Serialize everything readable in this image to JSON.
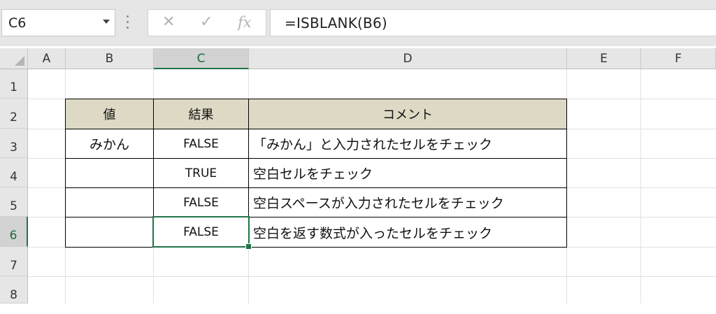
{
  "name_box": {
    "value": "C6"
  },
  "formula_bar": {
    "cancel_glyph": "✕",
    "enter_glyph": "✓",
    "fx_label": "fx",
    "formula": "=ISBLANK(B6)"
  },
  "columns": [
    "A",
    "B",
    "C",
    "D",
    "E",
    "F"
  ],
  "rows": [
    "1",
    "2",
    "3",
    "4",
    "5",
    "6",
    "7",
    "8"
  ],
  "selected_cell": {
    "column": "C",
    "row": "6"
  },
  "table": {
    "headers": [
      "値",
      "結果",
      "コメント"
    ],
    "rows": [
      {
        "value": "みかん",
        "result": "FALSE",
        "comment": "「みかん」と入力されたセルをチェック"
      },
      {
        "value": "",
        "result": "TRUE",
        "comment": "空白セルをチェック"
      },
      {
        "value": "",
        "result": "FALSE",
        "comment": "空白スペースが入力されたセルをチェック"
      },
      {
        "value": "",
        "result": "FALSE",
        "comment": "空白を返す数式が入ったセルをチェック"
      }
    ]
  },
  "colors": {
    "header_fill": "#ddd9c4",
    "selection": "#217346"
  }
}
